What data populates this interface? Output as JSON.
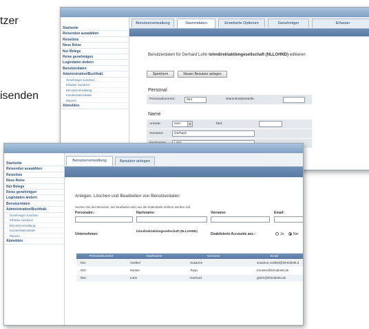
{
  "background_text": {
    "line1": "tzer",
    "line2": "isenden"
  },
  "window_back": {
    "sidebar": {
      "items": [
        {
          "label": "Startseite"
        },
        {
          "label": "Reisenden auswählen"
        },
        {
          "label": "Reiseliste"
        },
        {
          "label": "Neue Reise"
        },
        {
          "label": "Nur Belege"
        },
        {
          "label": "Reise genehmigen"
        },
        {
          "label": "Logindaten ändern"
        },
        {
          "label": "Benutzerdaten"
        },
        {
          "label": "Administration/Buchhalt."
        }
      ],
      "subitems": [
        {
          "label": "Genehmiger zuordnen"
        },
        {
          "label": "Erfasser zuordnen"
        },
        {
          "label": "Benutzerverwaltung"
        },
        {
          "label": "Kundenstammdaten"
        },
        {
          "label": "Reports"
        }
      ],
      "last": "Abmelden"
    },
    "tabs": [
      "Benutzerverwaltung",
      "Stammdaten",
      "Erweiterte Optionen",
      "Genehmiger",
      "Erfasser"
    ],
    "heading_prefix": "Benutzerdaten für Gerhard Lohn",
    "heading_company": "lohndirektaktiengesellschaft (NLLOHND)",
    "heading_suffix": "editieren",
    "buttons": {
      "save": "Speichern",
      "new_user": "Neuen Benutzer anlegen"
    },
    "personal": {
      "title": "Personal",
      "number_label": "Personalnummer:",
      "number_value": "004",
      "cost_center_label": "Stammkostenstelle:",
      "cost_center_value": ""
    },
    "name": {
      "title": "Name",
      "salutation_label": "Anrede:",
      "salutation_value": "Herr",
      "title_label": "Titel:",
      "title_value": "",
      "firstname_label": "Vorname:",
      "firstname_value": "Gerhard",
      "lastname_label": "Nachname:",
      "lastname_value": "Lohn"
    }
  },
  "window_front": {
    "sidebar": {
      "items": [
        {
          "label": "Startseite"
        },
        {
          "label": "Reisenden auswählen"
        },
        {
          "label": "Reiseliste"
        },
        {
          "label": "Neue Reise"
        },
        {
          "label": "Nur Belege"
        },
        {
          "label": "Reise genehmigen"
        },
        {
          "label": "Logindaten ändern"
        },
        {
          "label": "Benutzerdaten"
        },
        {
          "label": "Administration/Buchhalt."
        }
      ],
      "subitems": [
        {
          "label": "Genehmiger zuordnen"
        },
        {
          "label": "Erfasser zuordnen"
        },
        {
          "label": "Benutzerverwaltung"
        },
        {
          "label": "Kundenstammdaten"
        },
        {
          "label": "Reports"
        }
      ],
      "last": "Abmelden"
    },
    "tabs": [
      "Benutzerverwaltung",
      "Benutzer anlegen"
    ],
    "heading": "Anlegen, Löschen und Bearbeiten von Benutzerdaten",
    "search_hint": "Suchen Sie den Benutzer, der bearbeitet oder aus der Datenbank entfernt werden soll.",
    "filters": {
      "personalnr_label": "Personalnr.:",
      "nachname_label": "Nachname:",
      "vorname_label": "Vorname:",
      "email_label": "Email:",
      "unternehmen_label": "Unternehmen:",
      "unternehmen_value": "lohndirektaktiengesellschaft (NLLOHND)",
      "deaktivierte_label": "Deaktivierte Accounts anz.:",
      "ja_label": "Ja",
      "nein_label": "Nei"
    },
    "table": {
      "headers": [
        "Personalnummer",
        "Nachname",
        "Vorname",
        "Email"
      ],
      "rows": [
        [
          "001",
          "Voelkel",
          "Susanne",
          "susanne.voelkel@lohndirekt.d"
        ],
        [
          "003",
          "Muster",
          "Tanja",
          "tmuster@lohndirekt.de"
        ],
        [
          "004",
          "Lohn",
          "Gerhard",
          "glohn@lohndirekt.de"
        ]
      ]
    }
  }
}
